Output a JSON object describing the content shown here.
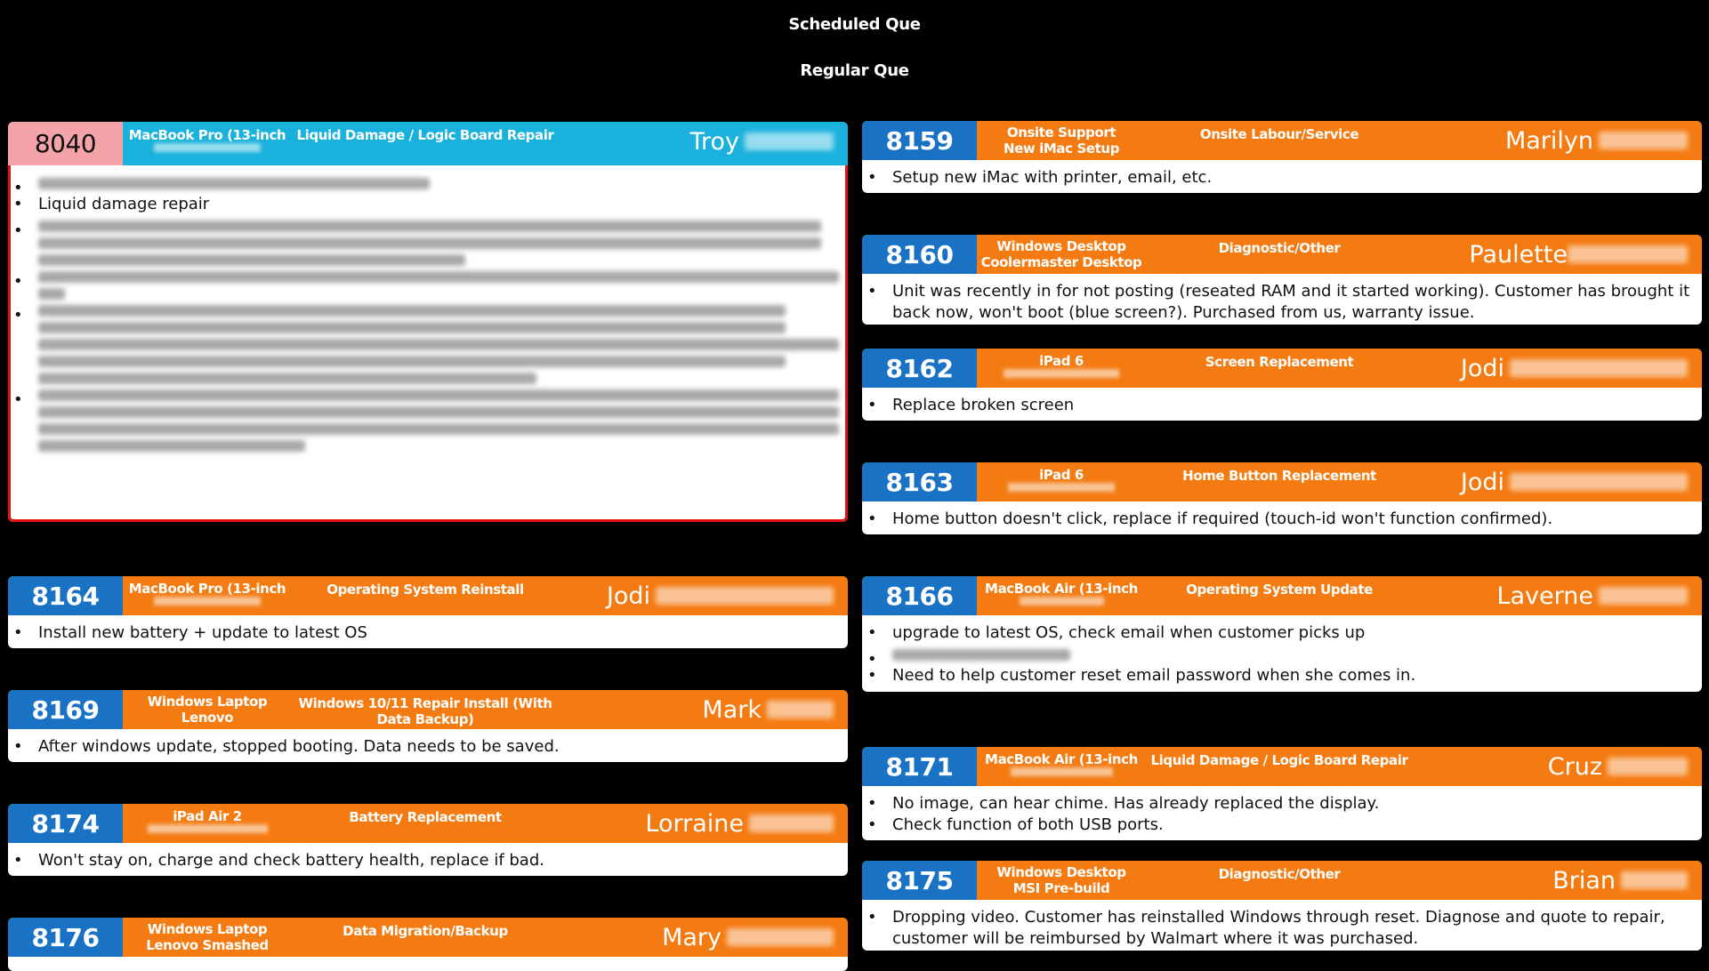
{
  "page": {
    "title": "Scheduled Que",
    "subtitle": "Regular Que"
  },
  "colors": {
    "background": "#000000",
    "orange": "#f47b12",
    "blue": "#1a72c4",
    "cyan": "#1ab2dc",
    "pink": "#f4a3a9",
    "selected_outline": "#e01010"
  },
  "left": [
    {
      "ticket": "8040",
      "device": "MacBook Pro (13-inch",
      "service": "Liquid Damage / Logic Board Repair",
      "tech": "Troy",
      "notes": [
        "Liquid damage repair"
      ]
    },
    {
      "ticket": "8164",
      "device": "MacBook Pro (13-inch",
      "service": "Operating System Reinstall",
      "tech": "Jodi",
      "notes": [
        "Install new battery + update to latest OS"
      ]
    },
    {
      "ticket": "8169",
      "device_line1": "Windows Laptop",
      "device_line2": "Lenovo",
      "service": "Windows 10/11 Repair Install (With Data Backup)",
      "tech": "Mark",
      "notes": [
        "After windows update, stopped booting. Data needs to be saved."
      ]
    },
    {
      "ticket": "8174",
      "device": "iPad Air 2",
      "service": "Battery Replacement",
      "tech": "Lorraine",
      "notes": [
        "Won't stay on, charge and check battery health, replace if bad."
      ]
    },
    {
      "ticket": "8176",
      "device_line1": "Windows Laptop",
      "device_line2": "Lenovo Smashed",
      "service": "Data Migration/Backup",
      "tech": "Mary",
      "notes": []
    }
  ],
  "right": [
    {
      "ticket": "8159",
      "device_line1": "Onsite Support",
      "device_line2": "New iMac Setup",
      "service": "Onsite Labour/Service",
      "tech": "Marilyn",
      "notes": [
        "Setup new iMac with printer, email, etc."
      ]
    },
    {
      "ticket": "8160",
      "device_line1": "Windows Desktop",
      "device_line2": "Coolermaster Desktop",
      "service": "Diagnostic/Other",
      "tech": "Paulette",
      "notes": [
        "Unit was recently in for not posting (reseated RAM and it started working). Customer has brought it back now, won't boot (blue screen?). Purchased from us, warranty issue."
      ]
    },
    {
      "ticket": "8162",
      "device": "iPad 6",
      "service": "Screen Replacement",
      "tech": "Jodi",
      "notes": [
        "Replace broken screen"
      ]
    },
    {
      "ticket": "8163",
      "device": "iPad 6",
      "service": "Home Button Replacement",
      "tech": "Jodi",
      "notes": [
        "Home button doesn't click, replace if required (touch-id won't function confirmed)."
      ]
    },
    {
      "ticket": "8166",
      "device": "MacBook Air (13-inch",
      "service": "Operating System Update",
      "tech": "Laverne",
      "notes": [
        "upgrade to latest OS, check email when customer picks up",
        "Need to help customer reset email password when she comes in."
      ]
    },
    {
      "ticket": "8171",
      "device": "MacBook Air (13-inch",
      "service": "Liquid Damage / Logic Board Repair",
      "tech": "Cruz",
      "notes": [
        "No image, can hear chime. Has already replaced the display.",
        "Check function of both USB ports."
      ]
    },
    {
      "ticket": "8175",
      "device_line1": "Windows Desktop",
      "device_line2": "MSI Pre-build",
      "service": "Diagnostic/Other",
      "tech": "Brian",
      "notes": [
        "Dropping video. Customer has reinstalled Windows through reset. Diagnose and quote to repair, customer will be reimbursed by Walmart where it was purchased."
      ]
    }
  ]
}
